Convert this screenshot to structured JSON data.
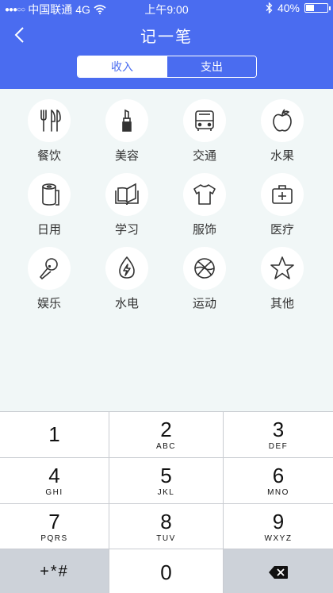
{
  "status_bar": {
    "signal": "●●●○○",
    "carrier": "中国联通",
    "network": "4G",
    "time": "上午9:00",
    "battery": "40%",
    "battery_level": 0.4
  },
  "nav": {
    "title": "记一笔"
  },
  "tabs": [
    {
      "label": "收入",
      "active": false
    },
    {
      "label": "支出",
      "active": true
    }
  ],
  "categories": [
    {
      "label": "餐饮",
      "icon": "utensils-icon"
    },
    {
      "label": "美容",
      "icon": "lipstick-icon"
    },
    {
      "label": "交通",
      "icon": "bus-icon"
    },
    {
      "label": "水果",
      "icon": "apple-icon"
    },
    {
      "label": "日用",
      "icon": "paper-roll-icon"
    },
    {
      "label": "学习",
      "icon": "book-icon"
    },
    {
      "label": "服饰",
      "icon": "tshirt-icon"
    },
    {
      "label": "医疗",
      "icon": "medical-kit-icon"
    },
    {
      "label": "娱乐",
      "icon": "microphone-icon"
    },
    {
      "label": "水电",
      "icon": "water-drop-bolt-icon"
    },
    {
      "label": "运动",
      "icon": "basketball-icon"
    },
    {
      "label": "其他",
      "icon": "star-icon"
    }
  ],
  "keypad": {
    "keys": [
      {
        "num": "1",
        "letters": ""
      },
      {
        "num": "2",
        "letters": "ABC"
      },
      {
        "num": "3",
        "letters": "DEF"
      },
      {
        "num": "4",
        "letters": "GHI"
      },
      {
        "num": "5",
        "letters": "JKL"
      },
      {
        "num": "6",
        "letters": "MNO"
      },
      {
        "num": "7",
        "letters": "PQRS"
      },
      {
        "num": "8",
        "letters": "TUV"
      },
      {
        "num": "9",
        "letters": "WXYZ"
      }
    ],
    "symbols": "+*#",
    "zero": "0",
    "delete_icon": "backspace-icon"
  },
  "colors": {
    "accent": "#4a6cf0",
    "background": "#f1f7f7"
  }
}
